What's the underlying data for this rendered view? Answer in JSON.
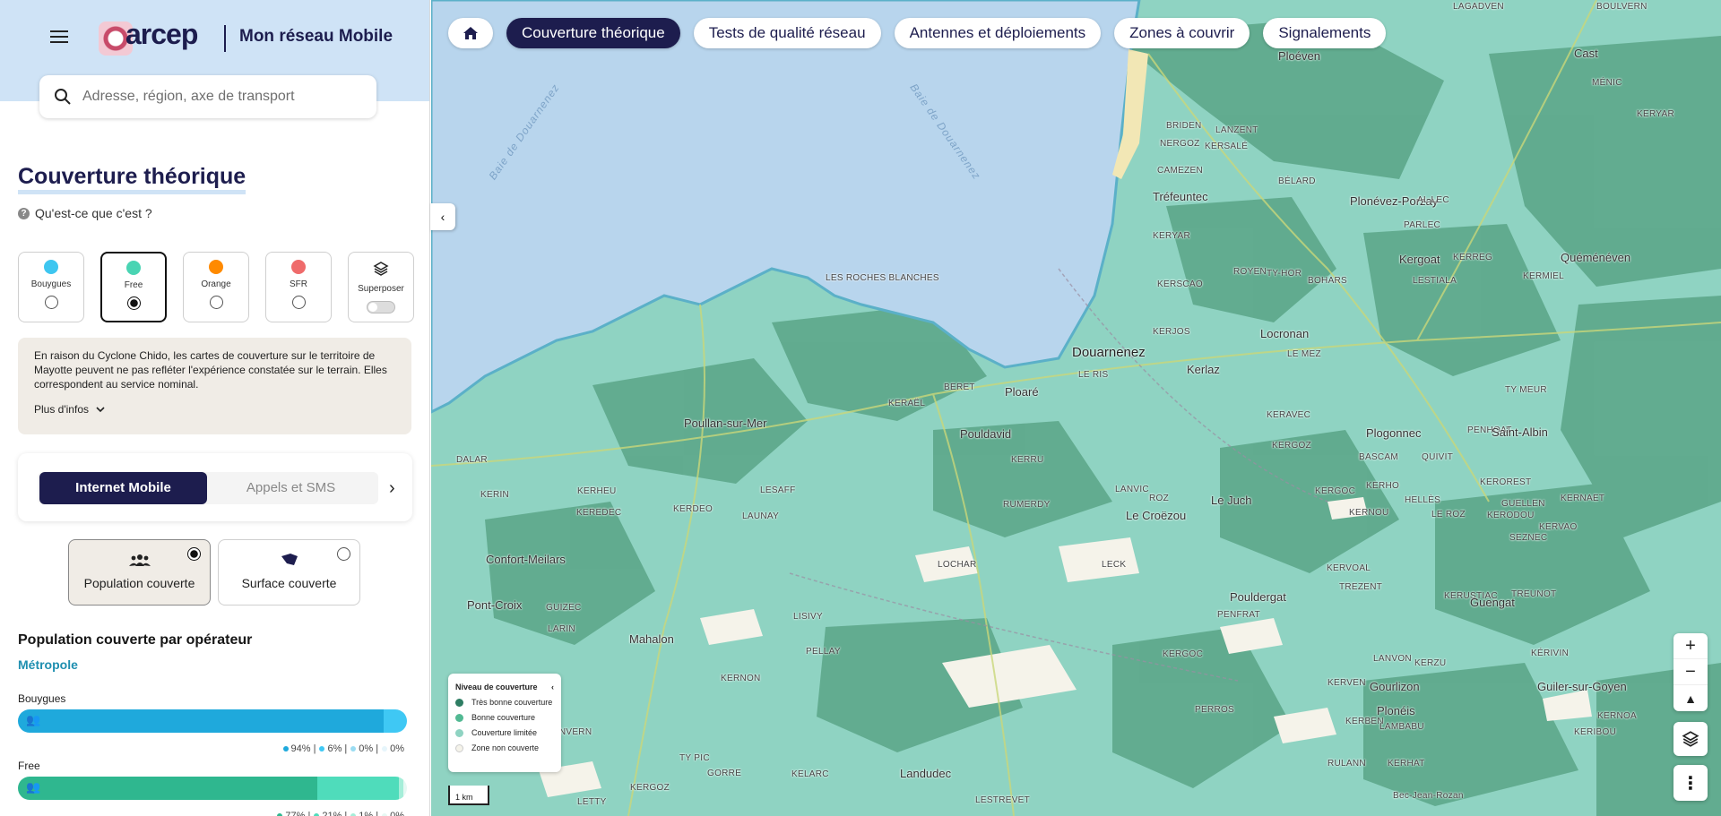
{
  "header": {
    "logo_text": "arcep",
    "app_title": "Mon réseau Mobile"
  },
  "search": {
    "placeholder": "Adresse, région, axe de transport"
  },
  "page": {
    "title": "Couverture théorique",
    "whatis": "Qu'est-ce que c'est ?"
  },
  "operators": [
    {
      "label": "Bouygues",
      "color": "#3ec6f0",
      "selected": false
    },
    {
      "label": "Free",
      "color": "#49d4b3",
      "selected": true
    },
    {
      "label": "Orange",
      "color": "#ff8a00",
      "selected": false
    },
    {
      "label": "SFR",
      "color": "#ef6b6b",
      "selected": false
    },
    {
      "label": "Superposer",
      "icon": "layers-icon",
      "toggle": false
    }
  ],
  "notice": {
    "text": "En raison du Cyclone Chido, les cartes de couverture sur le territoire de Mayotte peuvent ne pas refléter l'expérience constatée sur le terrain. Elles correspondent au service nominal.",
    "more": "Plus d'infos"
  },
  "service_tabs": {
    "internet": "Internet Mobile",
    "calls": "Appels et SMS"
  },
  "modes": {
    "population": "Population couverte",
    "surface": "Surface couverte"
  },
  "population": {
    "title": "Population couverte par opérateur",
    "region": "Métropole",
    "operators": [
      {
        "name": "Bouygues",
        "shares": [
          94,
          6,
          0,
          0
        ],
        "labels": [
          "94%",
          "6%",
          "0%",
          "0%"
        ],
        "colors": [
          "#1fa9dc",
          "#3fc8f4",
          "#9adcf2",
          "#e6f5fb"
        ]
      },
      {
        "name": "Free",
        "shares": [
          77,
          21,
          1,
          1
        ],
        "labels": [
          "77%",
          "21%",
          "1%",
          "0%"
        ],
        "colors": [
          "#2fb78f",
          "#4fdcbb",
          "#a5eed9",
          "#e6f8f3"
        ]
      }
    ]
  },
  "nav": {
    "home_icon": "home-icon",
    "tabs": [
      "Couverture théorique",
      "Tests de qualité réseau",
      "Antennes et déploiements",
      "Zones à couvrir",
      "Signalements"
    ],
    "active": 0
  },
  "map_legend": {
    "title": "Niveau de couverture",
    "items": [
      {
        "label": "Très bonne couverture",
        "color": "#2e7d63"
      },
      {
        "label": "Bonne couverture",
        "color": "#52b993"
      },
      {
        "label": "Couverture limitée",
        "color": "#8fd3c2"
      },
      {
        "label": "Zone non couverte",
        "color": "#f5f3ea"
      }
    ]
  },
  "scale": "1 km",
  "map_places": [
    {
      "name": "LAGADVEN",
      "cls": "small"
    },
    {
      "name": "BOULVERN",
      "cls": "small"
    },
    {
      "name": "Cast",
      "cls": ""
    },
    {
      "name": "Ploéven",
      "cls": ""
    },
    {
      "name": "MÉNIC",
      "cls": "small"
    },
    {
      "name": "KERYAR",
      "cls": "small"
    },
    {
      "name": "BRIDEN",
      "cls": "small"
    },
    {
      "name": "LANZENT",
      "cls": "small"
    },
    {
      "name": "NERGOZ",
      "cls": "small"
    },
    {
      "name": "KERSALÉ",
      "cls": "small"
    },
    {
      "name": "CAMEZEN",
      "cls": "small"
    },
    {
      "name": "BÉLARD",
      "cls": "small"
    },
    {
      "name": "Tréfeuntec",
      "cls": ""
    },
    {
      "name": "Plonévez-Porzay",
      "cls": ""
    },
    {
      "name": "AL LEC",
      "cls": "small"
    },
    {
      "name": "PARLEC",
      "cls": "small"
    },
    {
      "name": "KERYAR",
      "cls": "small"
    },
    {
      "name": "Kergoat",
      "cls": ""
    },
    {
      "name": "KERREG",
      "cls": "small"
    },
    {
      "name": "Quéménéven",
      "cls": ""
    },
    {
      "name": "ROYEN",
      "cls": "small"
    },
    {
      "name": "TY-HOR",
      "cls": "small"
    },
    {
      "name": "BOHARS",
      "cls": "small"
    },
    {
      "name": "LESTIALA",
      "cls": "small"
    },
    {
      "name": "KERMIEL",
      "cls": "small"
    },
    {
      "name": "LES ROCHES BLANCHES",
      "cls": "small"
    },
    {
      "name": "KERSCAO",
      "cls": "small"
    },
    {
      "name": "KERJOS",
      "cls": "small"
    },
    {
      "name": "Locronan",
      "cls": ""
    },
    {
      "name": "LE MEZ",
      "cls": "small"
    },
    {
      "name": "Douarnenez",
      "cls": "big"
    },
    {
      "name": "LE RIS",
      "cls": "small"
    },
    {
      "name": "Kerlaz",
      "cls": ""
    },
    {
      "name": "TY MEUR",
      "cls": "small"
    },
    {
      "name": "BERET",
      "cls": "small"
    },
    {
      "name": "Ploaré",
      "cls": ""
    },
    {
      "name": "Poullan-sur-Mer",
      "cls": ""
    },
    {
      "name": "KERAËL",
      "cls": "small"
    },
    {
      "name": "Pouldavid",
      "cls": ""
    },
    {
      "name": "KERAVEC",
      "cls": "small"
    },
    {
      "name": "Plogonnec",
      "cls": ""
    },
    {
      "name": "PENHOAT",
      "cls": "small"
    },
    {
      "name": "Saint-Albin",
      "cls": ""
    },
    {
      "name": "KERGOZ",
      "cls": "small"
    },
    {
      "name": "BASCAM",
      "cls": "small"
    },
    {
      "name": "QUIVIT",
      "cls": "small"
    },
    {
      "name": "DALAR",
      "cls": "small"
    },
    {
      "name": "KERRU",
      "cls": "small"
    },
    {
      "name": "KEROREST",
      "cls": "small"
    },
    {
      "name": "KERIN",
      "cls": "small"
    },
    {
      "name": "KERHEU",
      "cls": "small"
    },
    {
      "name": "LESAFF",
      "cls": "small"
    },
    {
      "name": "LANVIC",
      "cls": "small"
    },
    {
      "name": "ROZ",
      "cls": "small"
    },
    {
      "name": "Le Juch",
      "cls": ""
    },
    {
      "name": "KERGOC",
      "cls": "small"
    },
    {
      "name": "KERHO",
      "cls": "small"
    },
    {
      "name": "HELLÈS",
      "cls": "small"
    },
    {
      "name": "KERNAET",
      "cls": "small"
    },
    {
      "name": "GUELLEN",
      "cls": "small"
    },
    {
      "name": "KEREDEC",
      "cls": "small"
    },
    {
      "name": "KERDEO",
      "cls": "small"
    },
    {
      "name": "LAUNAY",
      "cls": "small"
    },
    {
      "name": "RUMERDY",
      "cls": "small"
    },
    {
      "name": "Le Croëzou",
      "cls": ""
    },
    {
      "name": "KERNOU",
      "cls": "small"
    },
    {
      "name": "KERODOU",
      "cls": "small"
    },
    {
      "name": "LE ROZ",
      "cls": "small"
    },
    {
      "name": "KERVAO",
      "cls": "small"
    },
    {
      "name": "SEZNEC",
      "cls": "small"
    },
    {
      "name": "Confort-Meilars",
      "cls": ""
    },
    {
      "name": "LOCHAR",
      "cls": "small"
    },
    {
      "name": "LECK",
      "cls": "small"
    },
    {
      "name": "KERVOAL",
      "cls": "small"
    },
    {
      "name": "TREZENT",
      "cls": "small"
    },
    {
      "name": "Pouldergat",
      "cls": ""
    },
    {
      "name": "KERUSTIAC",
      "cls": "small"
    },
    {
      "name": "Guengat",
      "cls": ""
    },
    {
      "name": "TREUNOT",
      "cls": "small"
    },
    {
      "name": "Pont-Croix",
      "cls": ""
    },
    {
      "name": "GUIZEC",
      "cls": "small"
    },
    {
      "name": "LARIN",
      "cls": "small"
    },
    {
      "name": "LISIVY",
      "cls": "small"
    },
    {
      "name": "PENFRAT",
      "cls": "small"
    },
    {
      "name": "Mahalon",
      "cls": ""
    },
    {
      "name": "PELLAY",
      "cls": "small"
    },
    {
      "name": "KERGOC",
      "cls": "small"
    },
    {
      "name": "LANVON",
      "cls": "small"
    },
    {
      "name": "KERZU",
      "cls": "small"
    },
    {
      "name": "KÉRIVIN",
      "cls": "small"
    },
    {
      "name": "KERVEN",
      "cls": "small"
    },
    {
      "name": "KERNON",
      "cls": "small"
    },
    {
      "name": "Gourlizon",
      "cls": ""
    },
    {
      "name": "Guiler-sur-Goyen",
      "cls": ""
    },
    {
      "name": "Plonéis",
      "cls": ""
    },
    {
      "name": "PERROS",
      "cls": "small"
    },
    {
      "name": "KERBEN",
      "cls": "small"
    },
    {
      "name": "LAMBABU",
      "cls": "small"
    },
    {
      "name": "KERIBOU",
      "cls": "small"
    },
    {
      "name": "KERNOA",
      "cls": "small"
    },
    {
      "name": "LANVERN",
      "cls": "small"
    },
    {
      "name": "TY PIC",
      "cls": "small"
    },
    {
      "name": "RULANN",
      "cls": "small"
    },
    {
      "name": "KERHAT",
      "cls": "small"
    },
    {
      "name": "GORRE",
      "cls": "small"
    },
    {
      "name": "KELARC",
      "cls": "small"
    },
    {
      "name": "Landudec",
      "cls": ""
    },
    {
      "name": "KERGOZ",
      "cls": "small"
    },
    {
      "name": "LETTY",
      "cls": "small"
    },
    {
      "name": "LESTREVET",
      "cls": "small"
    },
    {
      "name": "Bec-Jean-Rozan",
      "cls": "small"
    }
  ],
  "water_labels": [
    "Baie de Douarnenez",
    "Baie de Douarnenez"
  ]
}
